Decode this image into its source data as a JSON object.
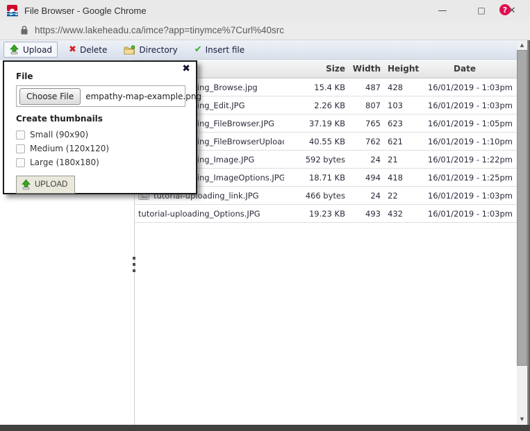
{
  "window": {
    "title": "File Browser - Google Chrome",
    "minimize_glyph": "—",
    "maximize_glyph": "□",
    "close_glyph": "✕"
  },
  "address_bar": {
    "url": "https://www.lakeheadu.ca/imce?app=tinymce%7Curl%40src"
  },
  "toolbar": {
    "buttons": [
      {
        "label": "Upload",
        "icon": "upload-arrow-icon",
        "active": true
      },
      {
        "label": "Delete",
        "icon": "red-x-icon",
        "active": false
      },
      {
        "label": "Directory",
        "icon": "folder-icon",
        "active": false
      },
      {
        "label": "Insert file",
        "icon": "green-check-icon",
        "active": false
      }
    ],
    "delete_glyph": "✖",
    "insert_glyph": "✔",
    "help_glyph": "?"
  },
  "upload_panel": {
    "close_glyph": "✖",
    "file_label": "File",
    "choose_file_button": "Choose File",
    "selected_file": "empathy-map-example.png",
    "thumbnails_label": "Create thumbnails",
    "thumbnail_options": [
      {
        "label": "Small (90x90)",
        "checked": false
      },
      {
        "label": "Medium (120x120)",
        "checked": false
      },
      {
        "label": "Large (180x180)",
        "checked": false
      }
    ],
    "upload_button": "UPLOAD"
  },
  "file_table": {
    "headers": {
      "name": "",
      "size": "Size",
      "width": "Width",
      "height": "Height",
      "date": "Date"
    },
    "rows": [
      {
        "name": "tutorial-uploading_Browse.jpg",
        "size": "15.4 KB",
        "width": "487",
        "height": "428",
        "date": "16/01/2019 - 1:03pm",
        "has_icon": false
      },
      {
        "name": "tutorial-uploading_Edit.JPG",
        "size": "2.26 KB",
        "width": "807",
        "height": "103",
        "date": "16/01/2019 - 1:03pm",
        "has_icon": false
      },
      {
        "name": "tutorial-uploading_FileBrowser.JPG",
        "size": "37.19 KB",
        "width": "765",
        "height": "623",
        "date": "16/01/2019 - 1:05pm",
        "has_icon": false
      },
      {
        "name": "tutorial-uploading_FileBrowserUpload.JPG",
        "size": "40.55 KB",
        "width": "762",
        "height": "621",
        "date": "16/01/2019 - 1:10pm",
        "has_icon": false
      },
      {
        "name": "tutorial-uploading_Image.JPG",
        "size": "592 bytes",
        "width": "24",
        "height": "21",
        "date": "16/01/2019 - 1:22pm",
        "has_icon": false
      },
      {
        "name": "tutorial-uploading_ImageOptions.JPG",
        "size": "18.71 KB",
        "width": "494",
        "height": "418",
        "date": "16/01/2019 - 1:25pm",
        "has_icon": false
      },
      {
        "name": "tutorial-uploading_link.JPG",
        "size": "466 bytes",
        "width": "24",
        "height": "22",
        "date": "16/01/2019 - 1:03pm",
        "has_icon": true
      },
      {
        "name": "tutorial-uploading_Options.JPG",
        "size": "19.23 KB",
        "width": "493",
        "height": "432",
        "date": "16/01/2019 - 1:03pm",
        "has_icon": false
      }
    ]
  },
  "scrollbar": {
    "up_glyph": "▲",
    "down_glyph": "▼"
  },
  "colors": {
    "help_red": "#e00e4e",
    "upload_green": "#3aa521",
    "delete_red": "#d21f1f",
    "check_green": "#2fae2f",
    "folder_yellow": "#e8c56a",
    "popup_border": "#1a1a1a"
  }
}
